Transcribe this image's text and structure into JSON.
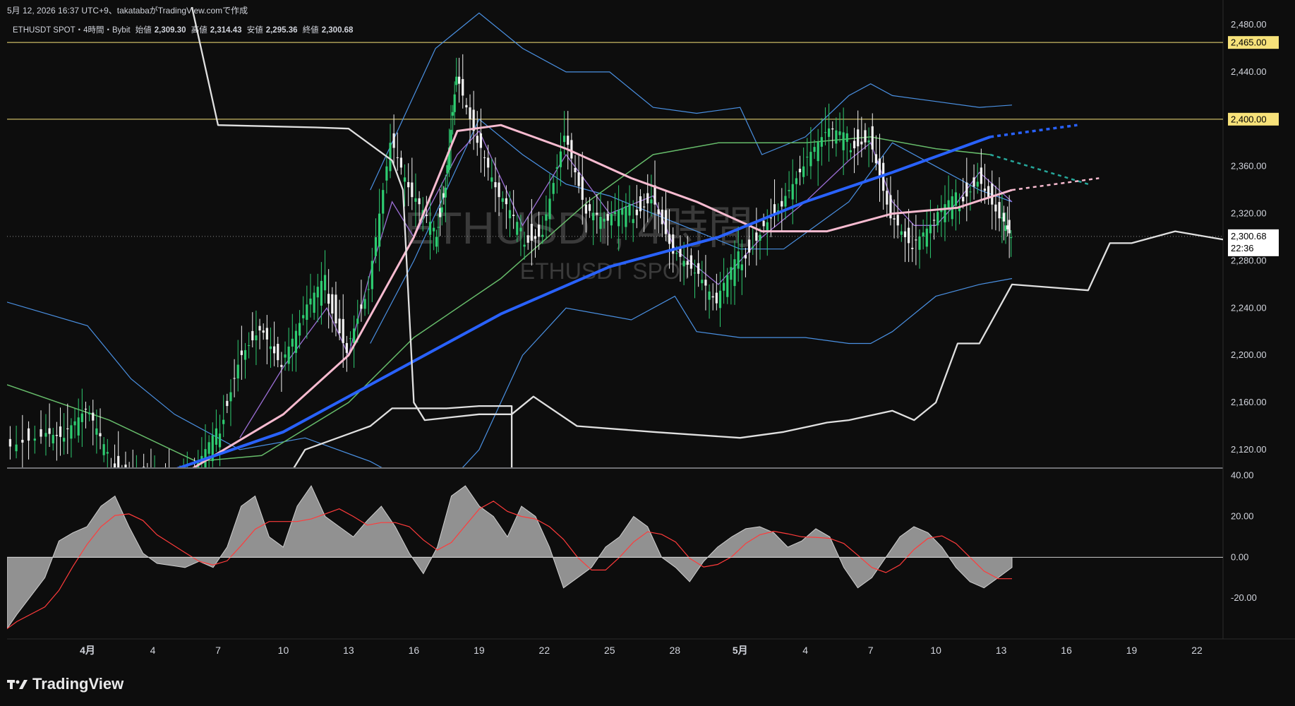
{
  "header": {
    "top_line": "5月 12, 2026 16:37 UTC+9、takatabaがTradingView.comで作成",
    "symbol": "ETHUSDT SPOT・4時間・Bybit",
    "open_label": "始値",
    "open_value": "2,309.30",
    "high_label": "高値",
    "high_value": "2,314.43",
    "low_label": "安値",
    "low_value": "2,295.36",
    "close_label": "終値",
    "close_value": "2,300.68"
  },
  "watermark": {
    "main": "ETHUSDT, 4時間",
    "sub": "ETHUSDT SPOT"
  },
  "footer": {
    "brand": "TradingView"
  },
  "colors": {
    "background": "#0d0d0d",
    "up_candle": "#2ecc71",
    "down_candle": "#f2f2f2",
    "horizontal_line": "#f7e27a",
    "ma_blue": "#2962ff",
    "ma_pink": "#f8bbd0",
    "ma_green": "#66bb6a",
    "bollinger": "#4a90e2",
    "fast_ma": "#9c6fd6",
    "projection_white": "#e0e0e0",
    "osc_fill": "#a9a9a9",
    "osc_signal": "#ff3b3b",
    "current_price_label": "#ffffff"
  },
  "chart_data": {
    "type": "line",
    "symbol": "ETHUSDT SPOT",
    "timeframe": "4時間",
    "exchange": "Bybit",
    "main_price_axis": {
      "ticks": [
        "2,480.00",
        "2,440.00",
        "2,400.00",
        "2,360.00",
        "2,320.00",
        "2,280.00",
        "2,240.00",
        "2,200.00",
        "2,160.00",
        "2,120.00"
      ],
      "range": [
        2105,
        2495
      ]
    },
    "oscillator_axis": {
      "ticks": [
        "40.00",
        "20.00",
        "0.00",
        "-20.00"
      ],
      "range": [
        -40,
        43
      ]
    },
    "x_axis_ticks": [
      "4月",
      "4",
      "7",
      "10",
      "13",
      "16",
      "19",
      "22",
      "25",
      "28",
      "5月",
      "4",
      "7",
      "10",
      "13",
      "16",
      "19",
      "22"
    ],
    "x_axis_ticks_day": [
      1,
      4,
      7,
      10,
      13,
      16,
      19,
      22,
      25,
      28,
      31,
      34,
      37,
      40,
      43,
      46,
      49,
      52
    ],
    "x_range_days": [
      -2.7,
      53.2
    ],
    "horizontal_lines": [
      {
        "price": 2465,
        "label": "2,465.00"
      },
      {
        "price": 2400,
        "label": "2,400.00"
      }
    ],
    "current_price": {
      "price": 2300.68,
      "label": "2,300.68",
      "countdown": "22:36"
    },
    "price_path": [
      [
        -2.7,
        2125
      ],
      [
        -1,
        2135
      ],
      [
        0,
        2130
      ],
      [
        1,
        2150
      ],
      [
        2,
        2110
      ],
      [
        3,
        2100
      ],
      [
        4,
        2095
      ],
      [
        5,
        2090
      ],
      [
        6,
        2095
      ],
      [
        7,
        2130
      ],
      [
        8,
        2200
      ],
      [
        9,
        2225
      ],
      [
        10,
        2190
      ],
      [
        11,
        2230
      ],
      [
        12,
        2260
      ],
      [
        13,
        2210
      ],
      [
        14,
        2260
      ],
      [
        15,
        2380
      ],
      [
        16,
        2330
      ],
      [
        17,
        2300
      ],
      [
        17.5,
        2350
      ],
      [
        18,
        2440
      ],
      [
        19,
        2380
      ],
      [
        20,
        2330
      ],
      [
        21,
        2300
      ],
      [
        22,
        2310
      ],
      [
        23,
        2390
      ],
      [
        24,
        2320
      ],
      [
        25,
        2310
      ],
      [
        26,
        2320
      ],
      [
        27,
        2340
      ],
      [
        28,
        2290
      ],
      [
        29,
        2270
      ],
      [
        30,
        2240
      ],
      [
        31,
        2280
      ],
      [
        32,
        2310
      ],
      [
        33,
        2330
      ],
      [
        34,
        2360
      ],
      [
        35,
        2385
      ],
      [
        36,
        2380
      ],
      [
        37,
        2390
      ],
      [
        38,
        2320
      ],
      [
        39,
        2290
      ],
      [
        40,
        2310
      ],
      [
        41,
        2330
      ],
      [
        42,
        2355
      ],
      [
        43,
        2320
      ],
      [
        43.5,
        2300
      ]
    ],
    "series": [
      {
        "kind": "ma_blue",
        "values": [
          [
            4.5,
            2100
          ],
          [
            10,
            2135
          ],
          [
            16,
            2195
          ],
          [
            20,
            2235
          ],
          [
            25,
            2275
          ],
          [
            30,
            2300
          ],
          [
            34,
            2330
          ],
          [
            38,
            2355
          ],
          [
            41,
            2375
          ],
          [
            42.5,
            2385
          ]
        ]
      },
      {
        "kind": "ma_blue_projection",
        "values": [
          [
            42.5,
            2385
          ],
          [
            46.5,
            2395
          ]
        ]
      },
      {
        "kind": "ma_pink",
        "values": [
          [
            5,
            2095
          ],
          [
            10,
            2150
          ],
          [
            13,
            2200
          ],
          [
            16,
            2300
          ],
          [
            18,
            2390
          ],
          [
            20,
            2395
          ],
          [
            23,
            2375
          ],
          [
            26,
            2350
          ],
          [
            29,
            2330
          ],
          [
            32,
            2305
          ],
          [
            35,
            2305
          ],
          [
            38,
            2320
          ],
          [
            41,
            2325
          ],
          [
            43.5,
            2340
          ]
        ]
      },
      {
        "kind": "ma_pink_projection",
        "values": [
          [
            43.5,
            2340
          ],
          [
            47.5,
            2350
          ]
        ]
      },
      {
        "kind": "ma_green",
        "values": [
          [
            -2.7,
            2175
          ],
          [
            2,
            2145
          ],
          [
            6,
            2110
          ],
          [
            9,
            2115
          ],
          [
            13,
            2160
          ],
          [
            16,
            2215
          ],
          [
            20,
            2265
          ],
          [
            24,
            2330
          ],
          [
            27,
            2370
          ],
          [
            30,
            2380
          ],
          [
            34,
            2380
          ],
          [
            37,
            2385
          ],
          [
            40,
            2375
          ],
          [
            42.5,
            2370
          ]
        ]
      },
      {
        "kind": "green_projection",
        "values": [
          [
            42.5,
            2370
          ],
          [
            47,
            2345
          ]
        ]
      },
      {
        "kind": "boll_upper",
        "values": [
          [
            14,
            2340
          ],
          [
            17,
            2460
          ],
          [
            19,
            2490
          ],
          [
            21,
            2460
          ],
          [
            23,
            2440
          ],
          [
            25,
            2440
          ],
          [
            27,
            2410
          ],
          [
            29,
            2405
          ],
          [
            31,
            2410
          ],
          [
            32,
            2370
          ],
          [
            34,
            2385
          ],
          [
            36,
            2420
          ],
          [
            37,
            2430
          ],
          [
            38,
            2420
          ],
          [
            40,
            2415
          ],
          [
            42,
            2410
          ],
          [
            43.5,
            2412
          ]
        ]
      },
      {
        "kind": "boll_mid",
        "values": [
          [
            14,
            2210
          ],
          [
            16,
            2280
          ],
          [
            19,
            2400
          ],
          [
            21,
            2370
          ],
          [
            23,
            2345
          ],
          [
            25,
            2335
          ],
          [
            27,
            2320
          ],
          [
            29,
            2305
          ],
          [
            31,
            2290
          ],
          [
            33,
            2290
          ],
          [
            36,
            2330
          ],
          [
            38,
            2380
          ],
          [
            40,
            2360
          ],
          [
            42,
            2340
          ],
          [
            43.5,
            2330
          ]
        ]
      },
      {
        "kind": "boll_lower",
        "values": [
          [
            -2.7,
            2245
          ],
          [
            1,
            2225
          ],
          [
            3,
            2180
          ],
          [
            5,
            2150
          ],
          [
            8,
            2120
          ],
          [
            11,
            2130
          ],
          [
            14,
            2110
          ],
          [
            17,
            2080
          ],
          [
            19,
            2120
          ],
          [
            21,
            2200
          ],
          [
            23,
            2240
          ],
          [
            26,
            2230
          ],
          [
            28,
            2250
          ],
          [
            29,
            2220
          ],
          [
            31,
            2215
          ],
          [
            34,
            2215
          ],
          [
            36,
            2210
          ],
          [
            37,
            2210
          ],
          [
            38,
            2220
          ],
          [
            40,
            2250
          ],
          [
            42,
            2260
          ],
          [
            43.5,
            2265
          ]
        ]
      },
      {
        "kind": "fast_ma",
        "values": [
          [
            8,
            2130
          ],
          [
            10,
            2190
          ],
          [
            12,
            2240
          ],
          [
            13,
            2200
          ],
          [
            14,
            2270
          ],
          [
            15,
            2330
          ],
          [
            16,
            2300
          ],
          [
            18,
            2370
          ],
          [
            19,
            2390
          ],
          [
            21,
            2310
          ],
          [
            23,
            2370
          ],
          [
            25,
            2320
          ],
          [
            27,
            2335
          ],
          [
            28,
            2290
          ],
          [
            30,
            2260
          ],
          [
            32,
            2300
          ],
          [
            34,
            2330
          ],
          [
            36,
            2365
          ],
          [
            37,
            2380
          ],
          [
            38,
            2330
          ],
          [
            39,
            2310
          ],
          [
            40,
            2310
          ],
          [
            41,
            2330
          ],
          [
            42,
            2355
          ],
          [
            43.5,
            2330
          ]
        ]
      },
      {
        "kind": "white_projection_upper",
        "values": [
          [
            5.5,
            2520
          ],
          [
            7,
            2395
          ],
          [
            11.5,
            2393
          ],
          [
            13,
            2392
          ],
          [
            15,
            2365
          ],
          [
            15.5,
            2340
          ],
          [
            16,
            2160
          ],
          [
            16.5,
            2145
          ],
          [
            19,
            2150
          ],
          [
            20.5,
            2150
          ],
          [
            21.5,
            2165
          ],
          [
            23.5,
            2140
          ],
          [
            27,
            2135
          ],
          [
            31,
            2130
          ],
          [
            33,
            2135
          ],
          [
            35,
            2143
          ],
          [
            36,
            2145
          ],
          [
            38,
            2153
          ],
          [
            39,
            2145
          ],
          [
            40,
            2160
          ],
          [
            41,
            2210
          ],
          [
            42,
            2210
          ],
          [
            43.5,
            2260
          ],
          [
            47,
            2255
          ],
          [
            48,
            2295
          ],
          [
            49,
            2295
          ],
          [
            51,
            2305
          ],
          [
            53.2,
            2298
          ]
        ]
      },
      {
        "kind": "white_projection_lower",
        "values": [
          [
            7,
            2080
          ],
          [
            10,
            2090
          ],
          [
            11,
            2120
          ],
          [
            14,
            2140
          ],
          [
            15,
            2155
          ],
          [
            17.5,
            2155
          ],
          [
            19,
            2157
          ],
          [
            20.5,
            2157
          ],
          [
            20.5,
            2000
          ]
        ]
      }
    ],
    "oscillator": {
      "fill": [
        [
          -2.7,
          -35
        ],
        [
          -2,
          -28
        ],
        [
          0,
          -10
        ],
        [
          1,
          8
        ],
        [
          2,
          12
        ],
        [
          3,
          15
        ],
        [
          4,
          25
        ],
        [
          5,
          30
        ],
        [
          6,
          15
        ],
        [
          7,
          2
        ],
        [
          8,
          -3
        ],
        [
          10,
          -5
        ],
        [
          11,
          -2
        ],
        [
          12,
          -5
        ],
        [
          13,
          5
        ],
        [
          14,
          25
        ],
        [
          15,
          30
        ],
        [
          16,
          10
        ],
        [
          17,
          5
        ],
        [
          18,
          25
        ],
        [
          19,
          35
        ],
        [
          20,
          20
        ],
        [
          21,
          15
        ],
        [
          22,
          10
        ],
        [
          23,
          18
        ],
        [
          24,
          25
        ],
        [
          25,
          15
        ],
        [
          26,
          2
        ],
        [
          27,
          -8
        ],
        [
          28,
          5
        ],
        [
          29,
          30
        ],
        [
          30,
          35
        ],
        [
          31,
          25
        ],
        [
          32,
          20
        ],
        [
          33,
          10
        ],
        [
          34,
          25
        ],
        [
          35,
          20
        ],
        [
          36,
          5
        ],
        [
          37,
          -15
        ],
        [
          38,
          -10
        ],
        [
          39,
          -5
        ],
        [
          40,
          5
        ],
        [
          41,
          10
        ],
        [
          42,
          20
        ],
        [
          43,
          15
        ],
        [
          44,
          0
        ],
        [
          45,
          -5
        ],
        [
          46,
          -12
        ],
        [
          47,
          -2
        ],
        [
          48,
          5
        ],
        [
          49,
          10
        ],
        [
          50,
          14
        ],
        [
          51,
          15
        ],
        [
          52,
          12
        ],
        [
          53,
          5
        ],
        [
          54,
          8
        ],
        [
          55,
          14
        ],
        [
          56,
          10
        ],
        [
          57,
          -5
        ],
        [
          58,
          -15
        ],
        [
          59,
          -10
        ],
        [
          60,
          0
        ],
        [
          61,
          10
        ],
        [
          62,
          15
        ],
        [
          63,
          12
        ],
        [
          64,
          5
        ],
        [
          65,
          -5
        ],
        [
          66,
          -12
        ],
        [
          67,
          -15
        ],
        [
          68,
          -10
        ],
        [
          69,
          -5
        ]
      ],
      "fill_index_days": [
        -2.7,
        43.5
      ]
    }
  }
}
